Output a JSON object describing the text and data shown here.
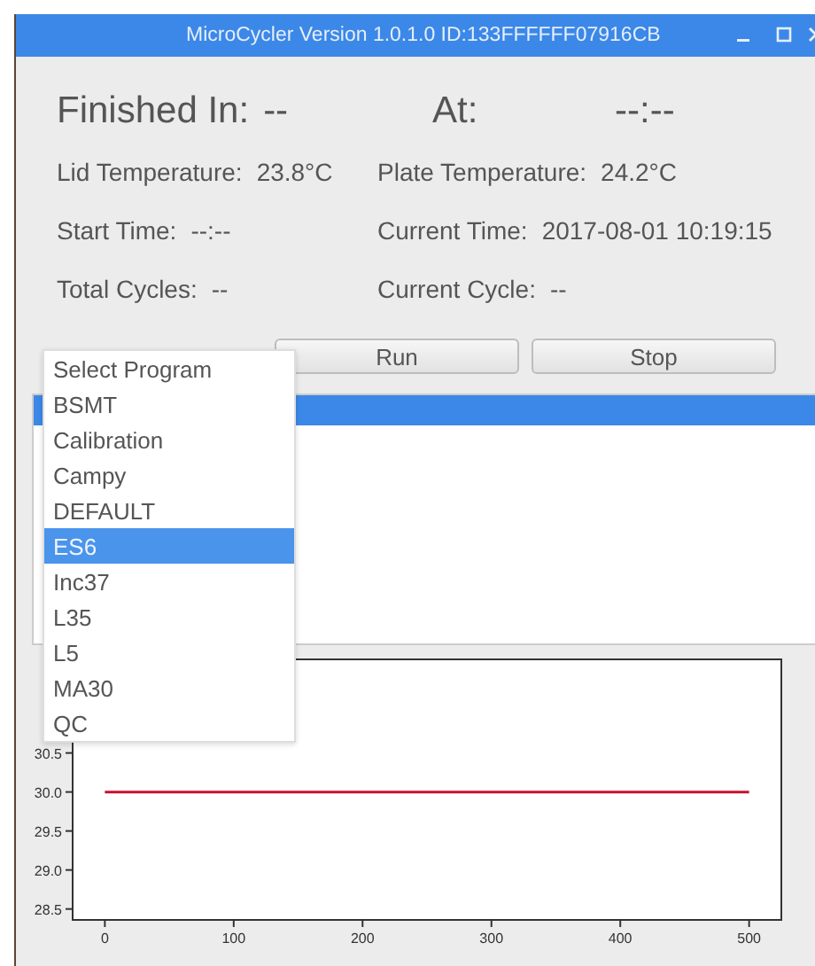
{
  "window": {
    "title": "MicroCycler Version 1.0.1.0  ID:133FFFFFF07916CB"
  },
  "finished": {
    "label": "Finished In:",
    "value": "--"
  },
  "at": {
    "label": "At:",
    "value": "--:--"
  },
  "left_readouts": [
    {
      "label": "Lid Temperature:",
      "value": "23.8°C"
    },
    {
      "label": "Start Time:",
      "value": "--:--"
    },
    {
      "label": "Total Cycles:",
      "value": "--"
    }
  ],
  "right_readouts": [
    {
      "label": "Plate Temperature:",
      "value": "24.2°C"
    },
    {
      "label": "Current Time:",
      "value": "2017-08-01 10:19:15"
    },
    {
      "label": "Current Cycle:",
      "value": "--"
    }
  ],
  "program_menu": {
    "items": [
      {
        "label": "Select Program",
        "selected": false
      },
      {
        "label": "BSMT",
        "selected": false
      },
      {
        "label": "Calibration",
        "selected": false
      },
      {
        "label": "Campy",
        "selected": false
      },
      {
        "label": "DEFAULT",
        "selected": false
      },
      {
        "label": "ES6",
        "selected": true
      },
      {
        "label": "Inc37",
        "selected": false
      },
      {
        "label": "L35",
        "selected": false
      },
      {
        "label": "L5",
        "selected": false
      },
      {
        "label": "MA30",
        "selected": false
      },
      {
        "label": "QC",
        "selected": false
      }
    ]
  },
  "buttons": [
    "Run",
    "Stop"
  ],
  "list_panel": {
    "rows": [
      {
        "selected": true
      }
    ]
  },
  "chart": {
    "chart_data": {
      "type": "line",
      "x": [
        0,
        500
      ],
      "series": [
        {
          "color": "#c8102e",
          "values": [
            30.0,
            30.0
          ]
        }
      ],
      "xlim": [
        -25,
        525
      ],
      "ylim": [
        28.36,
        31.7
      ],
      "xticks": [
        0,
        100,
        200,
        300,
        400,
        500
      ],
      "yticks": [
        {
          "value": 28.5,
          "label": "28.5"
        },
        {
          "value": 29.0,
          "label": "29.0"
        },
        {
          "value": 29.5,
          "label": "29.5"
        },
        {
          "value": 30.0,
          "label": "30.0"
        },
        {
          "value": 30.5,
          "label": "30.5"
        }
      ]
    }
  }
}
